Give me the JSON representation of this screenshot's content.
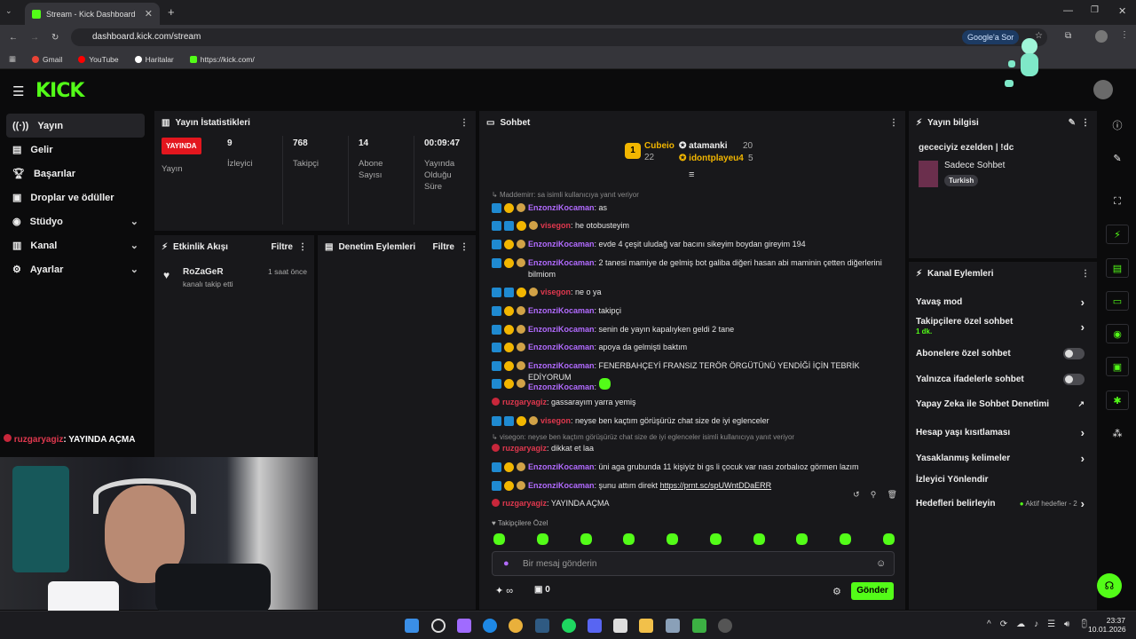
{
  "browser": {
    "tab_title": "Stream - Kick Dashboard",
    "url": "dashboard.kick.com/stream",
    "google_lens_label": "Google'a Sor",
    "bookmarks": [
      "Gmail",
      "YouTube",
      "Haritalar",
      "https://kick.com/"
    ]
  },
  "sidebar": {
    "items": [
      {
        "label": "Yayın"
      },
      {
        "label": "Gelir"
      },
      {
        "label": "Başarılar"
      },
      {
        "label": "Droplar ve ödüller"
      },
      {
        "label": "Stüdyo"
      },
      {
        "label": "Kanal"
      },
      {
        "label": "Ayarlar"
      }
    ]
  },
  "stats": {
    "title": "Yayın İstatistikleri",
    "live_badge": "YAYINDA",
    "live_label": "Yayın",
    "viewers_value": "9",
    "viewers_label": "İzleyici",
    "followers_value": "768",
    "followers_label": "Takipçi",
    "subs_value": "14",
    "subs_label": "Abone Sayısı",
    "uptime_value": "00:09:47",
    "uptime_label": "Yayında Olduğu Süre"
  },
  "activity": {
    "title": "Etkinlik Akışı",
    "filter": "Filtre",
    "event_user": "RoZaGeR",
    "event_text": "kanalı takip etti",
    "event_time": "1 saat önce"
  },
  "moderation": {
    "title": "Denetim Eylemleri",
    "filter": "Filtre"
  },
  "overlay_chat": {
    "user": "ruzgaryagiz",
    "message": ": YAYINDA AÇMA"
  },
  "chat": {
    "title": "Sohbet",
    "top": [
      {
        "name": "Cubeio",
        "count": "22"
      },
      {
        "name": "atamanki",
        "count": "20"
      },
      {
        "name": "idontplayeu4",
        "count": "5"
      }
    ],
    "reply1": "Maddemirr: sa isimli kullanıcıya yanıt veriyor",
    "reply2": "visegon: neyse ben kaçtım görüşürüz chat size de iyi eglenceler isimli kullanıcıya yanıt veriyor",
    "messages": [
      {
        "user": "EnzonziKocaman",
        "text": ": as"
      },
      {
        "user": "visegon",
        "text": ": he otobusteyim"
      },
      {
        "user": "EnzonziKocaman",
        "text": ": evde 4 çeşit uludağ var bacını sikeyim boydan gireyim 194"
      },
      {
        "user": "EnzonziKocaman",
        "text": ": 2 tanesi mamiye de gelmiş bot galiba diğeri hasan abi maminin çetten diğerlerini bilmiom"
      },
      {
        "user": "visegon",
        "text": ": ne o ya"
      },
      {
        "user": "EnzonziKocaman",
        "text": ": takipçi"
      },
      {
        "user": "EnzonziKocaman",
        "text": ": senin de yayın kapalıyken geldi 2 tane"
      },
      {
        "user": "EnzonziKocaman",
        "text": ": apoya da gelmişti baktım"
      },
      {
        "user": "EnzonziKocaman",
        "text": ": FENERBAHÇEYİ FRANSIZ TERÖR ÖRGÜTÜNÜ YENDİĞİ İÇİN TEBRİK EDİYORUM"
      },
      {
        "user": "EnzonziKocaman",
        "text": ":"
      },
      {
        "user": "ruzgaryagiz",
        "text": ": gassarayım yarra yemiş"
      },
      {
        "user": "visegon",
        "text": ": neyse ben kaçtım görüşürüz chat size de iyi eglenceler"
      },
      {
        "user": "ruzgaryagiz",
        "text": ": dikkat et laa"
      },
      {
        "user": "EnzonziKocaman",
        "text": ": üni aga grubunda 11 kişiyiz bi gs li çocuk var nası zorbalıoz görmen lazım"
      },
      {
        "user": "EnzonziKocaman",
        "text": ": şunu attım direkt"
      },
      {
        "user": "ruzgaryagiz",
        "text": ": YAYINDA AÇMA"
      }
    ],
    "link": "https://prnt.sc/spUWntDDaERR",
    "followers_only": "Takipçilere Özel",
    "input_placeholder": "Bir mesaj gönderin",
    "points": "∞",
    "store_count": "0",
    "send_label": "Gönder"
  },
  "stream_info": {
    "title_label": "Yayın bilgisi",
    "stream_title": "gececiyiz ezelden | !dc",
    "category": "Sadece Sohbet",
    "language": "Turkish"
  },
  "channel_actions": {
    "title": "Kanal Eylemleri",
    "slow_mode": "Yavaş mod",
    "followers_chat": "Takipçilere özel sohbet",
    "followers_chat_value": "1 dk.",
    "subs_chat": "Abonelere özel sohbet",
    "emote_chat": "Yalnızca ifadelerle sohbet",
    "ai_mod": "Yapay Zeka ile Sohbet Denetimi",
    "age_restrict": "Hesap yaşı kısıtlaması",
    "banned_words": "Yasaklanmış kelimeler",
    "viewer_guide": "İzleyici Yönlendir",
    "goals": "Hedefleri belirleyin",
    "goals_status": "Aktif hedefler - 2"
  },
  "taskbar": {
    "time": "23:37",
    "date": "10.01.2026"
  },
  "colors": {
    "accent": "#53fc18",
    "live": "#e3161e",
    "panel": "#18181b"
  }
}
